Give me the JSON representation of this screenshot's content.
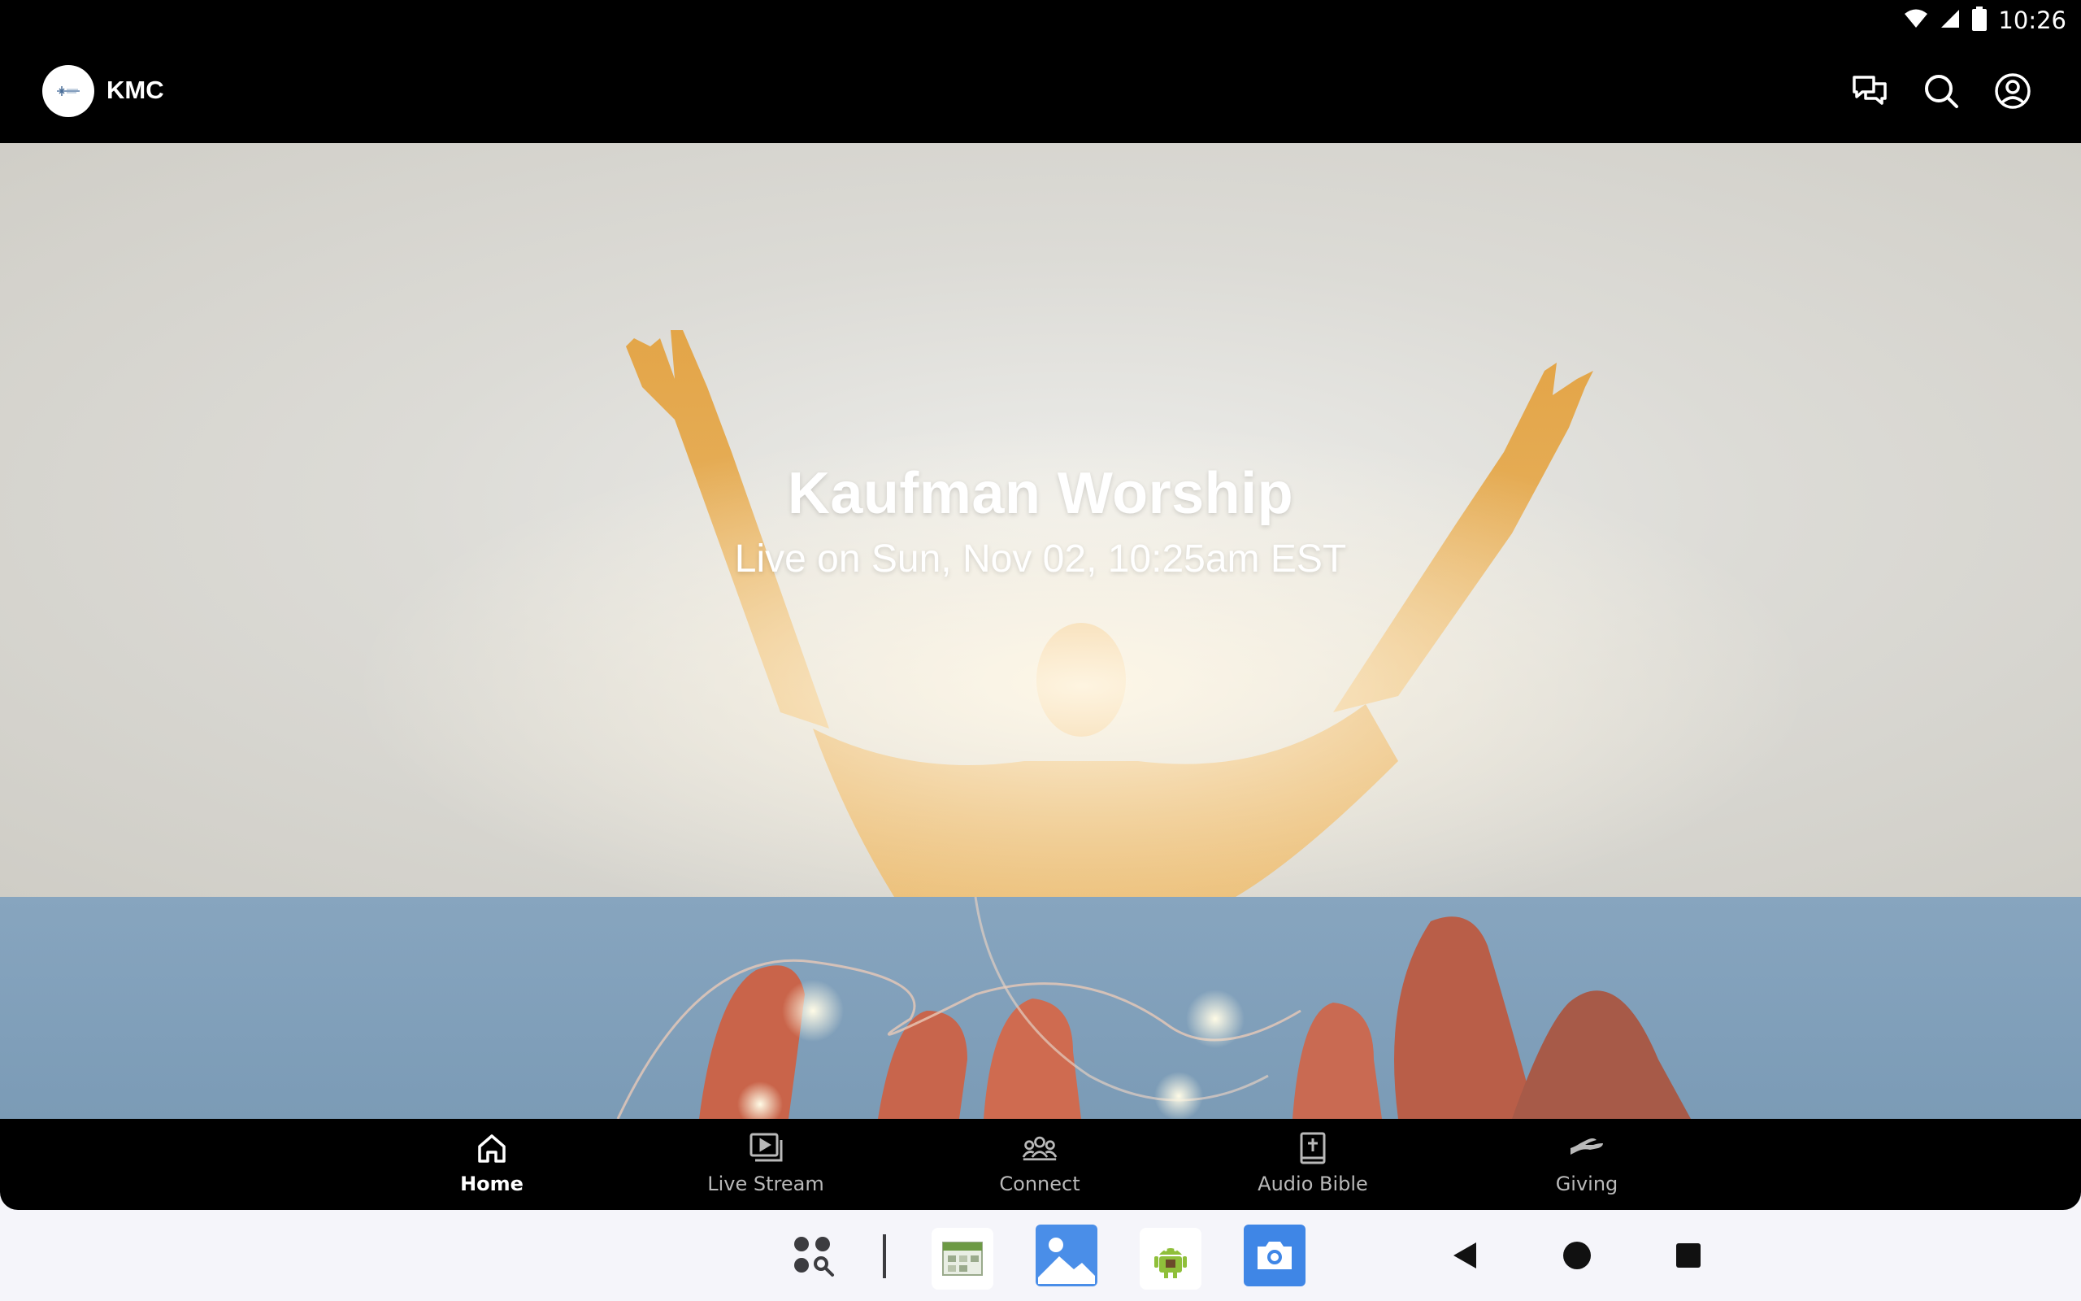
{
  "status_bar": {
    "time": "10:26"
  },
  "app_bar": {
    "title": "KMC",
    "actions": [
      "chat-icon",
      "search-icon",
      "account-icon"
    ]
  },
  "hero": {
    "title": "Kaufman Worship",
    "subtitle": "Live on Sun, Nov 02, 10:25am EST"
  },
  "bottom_nav": {
    "items": [
      {
        "label": "Home",
        "icon": "home-icon",
        "active": true
      },
      {
        "label": "Live Stream",
        "icon": "live-stream-icon",
        "active": false
      },
      {
        "label": "Connect",
        "icon": "people-icon",
        "active": false
      },
      {
        "label": "Audio Bible",
        "icon": "bible-icon",
        "active": false
      },
      {
        "label": "Giving",
        "icon": "giving-hand-icon",
        "active": false
      }
    ]
  },
  "system_bar": {
    "apps": [
      "app-search-icon",
      "calendar-app-icon",
      "gallery-app-icon",
      "android-app-icon",
      "camera-app-icon"
    ],
    "nav": [
      "back-icon",
      "home-circle-icon",
      "recents-icon"
    ]
  },
  "colors": {
    "bar_background": "#000000",
    "hero_background": "#dcdbd6",
    "banner_background": "#7b9bb6",
    "nav_active": "#ffffff",
    "nav_inactive": "#b9b9b9"
  }
}
